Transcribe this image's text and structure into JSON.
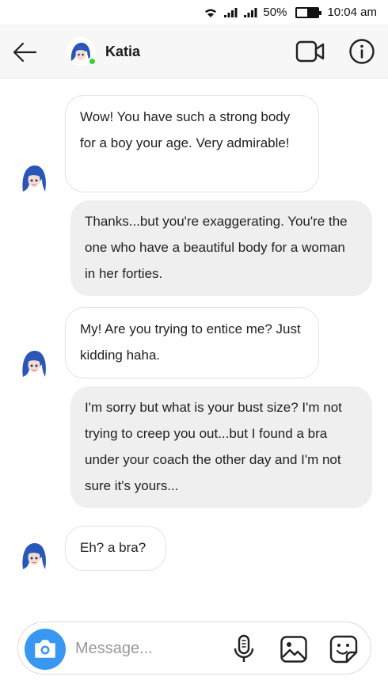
{
  "status_bar": {
    "battery_percent": "50%",
    "battery_level": 0.5,
    "time": "10:04 am",
    "icons": [
      "wifi-icon",
      "signal-icon",
      "signal-icon",
      "battery-icon"
    ]
  },
  "header": {
    "back_icon": "arrow-left-icon",
    "contact_name": "Katia",
    "online": true,
    "video_icon": "video-camera-icon",
    "info_icon": "info-icon"
  },
  "messages": [
    {
      "from": "contact",
      "text": "Wow! You have such a strong body for a boy your age. Very admirable!"
    },
    {
      "from": "me",
      "text": "Thanks...but you're exaggerating. You're the one who have a beautiful body for a woman in her forties."
    },
    {
      "from": "contact",
      "text": "My! Are you trying to entice me? Just kidding haha."
    },
    {
      "from": "me",
      "text": "I'm sorry but what is your bust size? I'm not trying to creep you out...but I found a bra under your coach the other day and I'm not sure it's yours..."
    },
    {
      "from": "contact",
      "text": "Eh? a bra?"
    }
  ],
  "composer": {
    "placeholder": "Message...",
    "camera_icon": "camera-icon",
    "mic_icon": "microphone-icon",
    "gallery_icon": "image-icon",
    "sticker_icon": "sticker-icon"
  },
  "colors": {
    "accent": "#3897f0",
    "online": "#3ccf3c",
    "outgoing_bubble": "#efefef",
    "header_bg": "#f7f7f7"
  }
}
